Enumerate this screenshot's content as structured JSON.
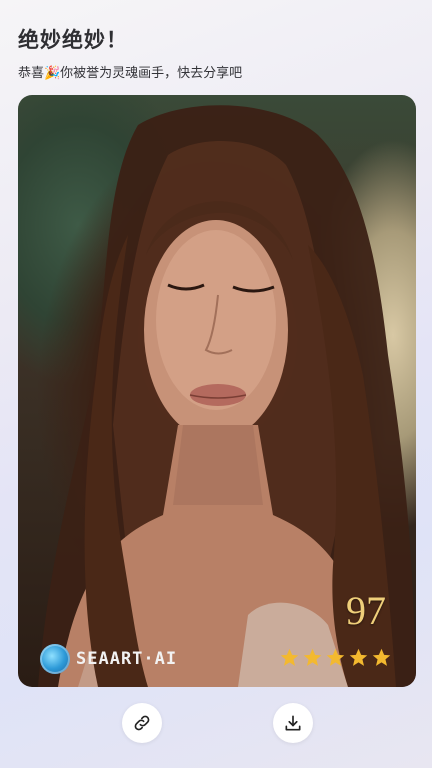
{
  "header": {
    "title": "绝妙绝妙！",
    "message": "恭喜🎉你被誉为灵魂画手，快去分享吧"
  },
  "card": {
    "image_alt": "AI generated portrait of a woman with long brown hair and closed eyes",
    "brand": "SEAART·AI",
    "score": "97",
    "rating": 5,
    "star_color": "#f3b92f",
    "score_color": "#efcf7a"
  },
  "actions": {
    "share_icon": "link-icon",
    "download_icon": "download-icon"
  }
}
